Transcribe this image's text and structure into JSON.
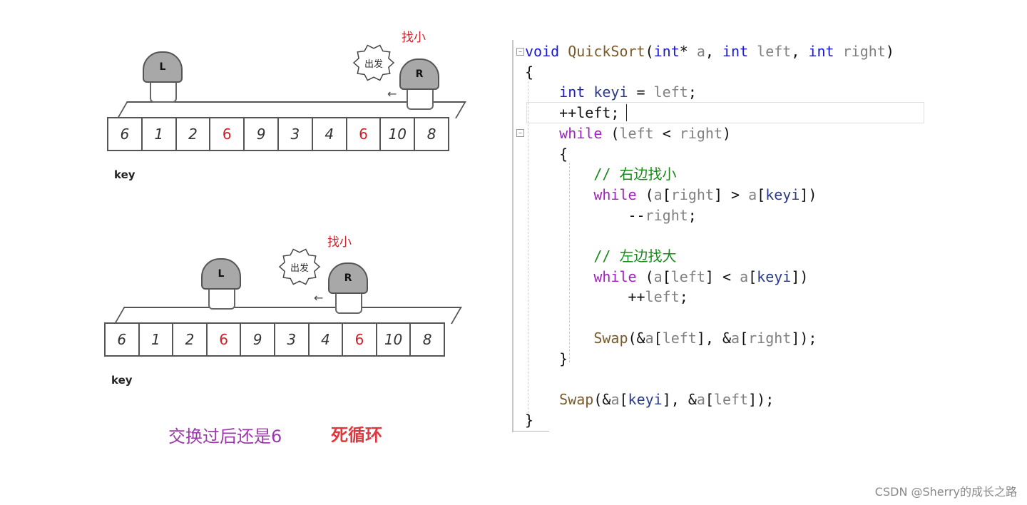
{
  "diagram": {
    "scenes": [
      {
        "array": [
          {
            "value": "6",
            "highlight": false
          },
          {
            "value": "1",
            "highlight": false
          },
          {
            "value": "2",
            "highlight": false
          },
          {
            "value": "6",
            "highlight": true
          },
          {
            "value": "9",
            "highlight": false
          },
          {
            "value": "3",
            "highlight": false
          },
          {
            "value": "4",
            "highlight": false
          },
          {
            "value": "6",
            "highlight": true
          },
          {
            "value": "10",
            "highlight": false
          },
          {
            "value": "8",
            "highlight": false
          }
        ],
        "key_label": "key",
        "left_marker": "L",
        "right_marker": "R",
        "bubble_text": "出发",
        "find_label": "找小",
        "arrow": "←"
      },
      {
        "array": [
          {
            "value": "6",
            "highlight": false
          },
          {
            "value": "1",
            "highlight": false
          },
          {
            "value": "2",
            "highlight": false
          },
          {
            "value": "6",
            "highlight": true
          },
          {
            "value": "9",
            "highlight": false
          },
          {
            "value": "3",
            "highlight": false
          },
          {
            "value": "4",
            "highlight": false
          },
          {
            "value": "6",
            "highlight": true
          },
          {
            "value": "10",
            "highlight": false
          },
          {
            "value": "8",
            "highlight": false
          }
        ],
        "key_label": "key",
        "left_marker": "L",
        "right_marker": "R",
        "bubble_text": "出发",
        "find_label": "找小",
        "arrow": "←"
      }
    ],
    "caption_note": "交换过后还是6",
    "caption_warning": "死循环",
    "colors": {
      "note": "#9a3aa8",
      "warning": "#e0383e",
      "highlight": "#d0202a"
    }
  },
  "code": {
    "lines": [
      [
        {
          "t": "void ",
          "c": "kw"
        },
        {
          "t": "QuickSort",
          "c": "fn"
        },
        {
          "t": "(",
          "c": "txt"
        },
        {
          "t": "int",
          "c": "kw"
        },
        {
          "t": "* ",
          "c": "txt"
        },
        {
          "t": "a",
          "c": "par"
        },
        {
          "t": ", ",
          "c": "txt"
        },
        {
          "t": "int ",
          "c": "kw"
        },
        {
          "t": "left",
          "c": "par"
        },
        {
          "t": ", ",
          "c": "txt"
        },
        {
          "t": "int ",
          "c": "kw"
        },
        {
          "t": "right",
          "c": "par"
        },
        {
          "t": ")",
          "c": "txt"
        }
      ],
      [
        {
          "t": "{",
          "c": "txt"
        }
      ],
      [
        {
          "t": "    ",
          "c": "txt"
        },
        {
          "t": "int ",
          "c": "kw"
        },
        {
          "t": "keyi",
          "c": "loc"
        },
        {
          "t": " = ",
          "c": "txt"
        },
        {
          "t": "left",
          "c": "par"
        },
        {
          "t": ";",
          "c": "txt"
        }
      ],
      [
        {
          "t": "    ++",
          "c": "txt"
        },
        {
          "t": "left",
          "c": "txt"
        },
        {
          "t": ";",
          "c": "txt"
        }
      ],
      [
        {
          "t": "    ",
          "c": "txt"
        },
        {
          "t": "while",
          "c": "kw2"
        },
        {
          "t": " (",
          "c": "txt"
        },
        {
          "t": "left",
          "c": "par"
        },
        {
          "t": " < ",
          "c": "txt"
        },
        {
          "t": "right",
          "c": "par"
        },
        {
          "t": ")",
          "c": "txt"
        }
      ],
      [
        {
          "t": "    {",
          "c": "txt"
        }
      ],
      [
        {
          "t": "        ",
          "c": "txt"
        },
        {
          "t": "// 右边找小",
          "c": "cmt"
        }
      ],
      [
        {
          "t": "        ",
          "c": "txt"
        },
        {
          "t": "while",
          "c": "kw2"
        },
        {
          "t": " (",
          "c": "txt"
        },
        {
          "t": "a",
          "c": "par"
        },
        {
          "t": "[",
          "c": "txt"
        },
        {
          "t": "right",
          "c": "par"
        },
        {
          "t": "] > ",
          "c": "txt"
        },
        {
          "t": "a",
          "c": "par"
        },
        {
          "t": "[",
          "c": "txt"
        },
        {
          "t": "keyi",
          "c": "loc"
        },
        {
          "t": "])",
          "c": "txt"
        }
      ],
      [
        {
          "t": "            --",
          "c": "txt"
        },
        {
          "t": "right",
          "c": "par"
        },
        {
          "t": ";",
          "c": "txt"
        }
      ],
      [
        {
          "t": "",
          "c": "txt"
        }
      ],
      [
        {
          "t": "        ",
          "c": "txt"
        },
        {
          "t": "// 左边找大",
          "c": "cmt"
        }
      ],
      [
        {
          "t": "        ",
          "c": "txt"
        },
        {
          "t": "while",
          "c": "kw2"
        },
        {
          "t": " (",
          "c": "txt"
        },
        {
          "t": "a",
          "c": "par"
        },
        {
          "t": "[",
          "c": "txt"
        },
        {
          "t": "left",
          "c": "par"
        },
        {
          "t": "] < ",
          "c": "txt"
        },
        {
          "t": "a",
          "c": "par"
        },
        {
          "t": "[",
          "c": "txt"
        },
        {
          "t": "keyi",
          "c": "loc"
        },
        {
          "t": "])",
          "c": "txt"
        }
      ],
      [
        {
          "t": "            ++",
          "c": "txt"
        },
        {
          "t": "left",
          "c": "par"
        },
        {
          "t": ";",
          "c": "txt"
        }
      ],
      [
        {
          "t": "",
          "c": "txt"
        }
      ],
      [
        {
          "t": "        ",
          "c": "txt"
        },
        {
          "t": "Swap",
          "c": "fn"
        },
        {
          "t": "(&",
          "c": "txt"
        },
        {
          "t": "a",
          "c": "par"
        },
        {
          "t": "[",
          "c": "txt"
        },
        {
          "t": "left",
          "c": "par"
        },
        {
          "t": "], &",
          "c": "txt"
        },
        {
          "t": "a",
          "c": "par"
        },
        {
          "t": "[",
          "c": "txt"
        },
        {
          "t": "right",
          "c": "par"
        },
        {
          "t": "]);",
          "c": "txt"
        }
      ],
      [
        {
          "t": "    }",
          "c": "txt"
        }
      ],
      [
        {
          "t": "",
          "c": "txt"
        }
      ],
      [
        {
          "t": "    ",
          "c": "txt"
        },
        {
          "t": "Swap",
          "c": "fn"
        },
        {
          "t": "(&",
          "c": "txt"
        },
        {
          "t": "a",
          "c": "par"
        },
        {
          "t": "[",
          "c": "txt"
        },
        {
          "t": "keyi",
          "c": "loc"
        },
        {
          "t": "], &",
          "c": "txt"
        },
        {
          "t": "a",
          "c": "par"
        },
        {
          "t": "[",
          "c": "txt"
        },
        {
          "t": "left",
          "c": "par"
        },
        {
          "t": "]);",
          "c": "txt"
        }
      ],
      [
        {
          "t": "}",
          "c": "txt"
        }
      ]
    ],
    "fold_markers": [
      "−",
      "−"
    ]
  },
  "watermark": "CSDN @Sherry的成长之路"
}
